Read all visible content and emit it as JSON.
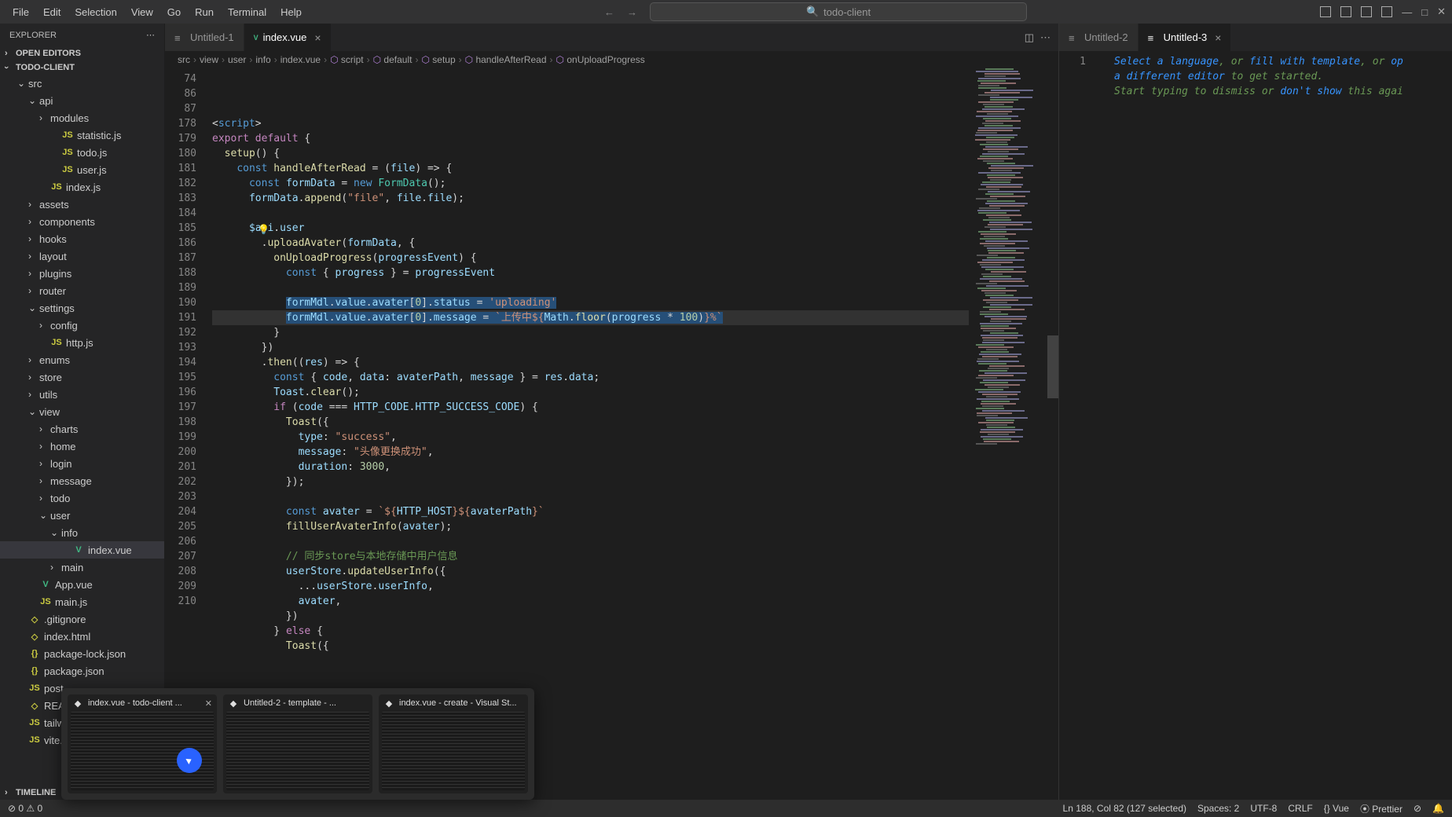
{
  "menu": [
    "File",
    "Edit",
    "Selection",
    "View",
    "Go",
    "Run",
    "Terminal",
    "Help"
  ],
  "searchPlaceholder": "todo-client",
  "explorer": {
    "title": "EXPLORER",
    "openEditors": "OPEN EDITORS",
    "project": "TODO-CLIENT",
    "timeline": "TIMELINE",
    "tree": [
      {
        "depth": 1,
        "type": "folder",
        "open": true,
        "label": "src"
      },
      {
        "depth": 2,
        "type": "folder",
        "open": true,
        "label": "api"
      },
      {
        "depth": 3,
        "type": "folder",
        "open": false,
        "label": "modules"
      },
      {
        "depth": 4,
        "type": "js",
        "label": "statistic.js"
      },
      {
        "depth": 4,
        "type": "js",
        "label": "todo.js"
      },
      {
        "depth": 4,
        "type": "js",
        "label": "user.js"
      },
      {
        "depth": 3,
        "type": "js",
        "label": "index.js"
      },
      {
        "depth": 2,
        "type": "folder",
        "open": false,
        "label": "assets"
      },
      {
        "depth": 2,
        "type": "folder",
        "open": false,
        "label": "components"
      },
      {
        "depth": 2,
        "type": "folder",
        "open": false,
        "label": "hooks"
      },
      {
        "depth": 2,
        "type": "folder",
        "open": false,
        "label": "layout"
      },
      {
        "depth": 2,
        "type": "folder",
        "open": false,
        "label": "plugins"
      },
      {
        "depth": 2,
        "type": "folder",
        "open": false,
        "label": "router"
      },
      {
        "depth": 2,
        "type": "folder",
        "open": true,
        "label": "settings"
      },
      {
        "depth": 3,
        "type": "folder",
        "open": false,
        "label": "config"
      },
      {
        "depth": 3,
        "type": "js",
        "label": "http.js"
      },
      {
        "depth": 2,
        "type": "folder",
        "open": false,
        "label": "enums"
      },
      {
        "depth": 2,
        "type": "folder",
        "open": false,
        "label": "store"
      },
      {
        "depth": 2,
        "type": "folder",
        "open": false,
        "label": "utils"
      },
      {
        "depth": 2,
        "type": "folder",
        "open": true,
        "label": "view"
      },
      {
        "depth": 3,
        "type": "folder",
        "open": false,
        "label": "charts"
      },
      {
        "depth": 3,
        "type": "folder",
        "open": false,
        "label": "home"
      },
      {
        "depth": 3,
        "type": "folder",
        "open": false,
        "label": "login"
      },
      {
        "depth": 3,
        "type": "folder",
        "open": false,
        "label": "message"
      },
      {
        "depth": 3,
        "type": "folder",
        "open": false,
        "label": "todo"
      },
      {
        "depth": 3,
        "type": "folder",
        "open": true,
        "label": "user"
      },
      {
        "depth": 4,
        "type": "folder",
        "open": true,
        "label": "info"
      },
      {
        "depth": 5,
        "type": "vue",
        "label": "index.vue",
        "selected": true
      },
      {
        "depth": 4,
        "type": "folder",
        "open": false,
        "label": "main"
      },
      {
        "depth": 2,
        "type": "vue",
        "label": "App.vue"
      },
      {
        "depth": 2,
        "type": "js",
        "label": "main.js"
      },
      {
        "depth": 1,
        "type": "file",
        "label": ".gitignore"
      },
      {
        "depth": 1,
        "type": "file",
        "label": "index.html"
      },
      {
        "depth": 1,
        "type": "json",
        "label": "package-lock.json"
      },
      {
        "depth": 1,
        "type": "json",
        "label": "package.json"
      },
      {
        "depth": 1,
        "type": "js",
        "label": "post"
      },
      {
        "depth": 1,
        "type": "file",
        "label": "REA"
      },
      {
        "depth": 1,
        "type": "js",
        "label": "tailw"
      },
      {
        "depth": 1,
        "type": "js",
        "label": "vite.c"
      }
    ]
  },
  "leftTabs": [
    {
      "label": "Untitled-1",
      "active": false
    },
    {
      "label": "index.vue",
      "active": true,
      "icon": "vue"
    }
  ],
  "rightTabs": [
    {
      "label": "Untitled-2",
      "active": false
    },
    {
      "label": "Untitled-3",
      "active": true
    }
  ],
  "breadcrumbs": [
    "src",
    "view",
    "user",
    "info",
    "index.vue",
    "script",
    "default",
    "setup",
    "handleAfterRead",
    "onUploadProgress"
  ],
  "rightEditor": {
    "lineNo": "1",
    "text1a": "Select a language",
    "text1b": ", or ",
    "link1": "fill with template",
    "text1c": ", or ",
    "link2": "op",
    "text2a": "a different editor",
    "text2b": " to get started.",
    "text3a": "Start typing to dismiss or ",
    "link3": "don't show",
    "text3b": " this agai"
  },
  "code": {
    "lines": [
      {
        "n": 74,
        "html": "<span class='op'>&lt;</span><span class='kw'>script</span><span class='op'>&gt;</span>"
      },
      {
        "n": 86,
        "html": "<span class='kw2'>export</span> <span class='kw2'>default</span> <span class='op'>{</span>"
      },
      {
        "n": 87,
        "html": "  <span class='fn'>setup</span><span class='op'>() {</span>"
      },
      {
        "n": 178,
        "html": "    <span class='kw'>const</span> <span class='fn'>handleAfterRead</span> <span class='op'>= (</span><span class='var'>file</span><span class='op'>) =&gt; {</span>"
      },
      {
        "n": 179,
        "html": "      <span class='kw'>const</span> <span class='var'>formData</span> <span class='op'>=</span> <span class='kw'>new</span> <span class='cls'>FormData</span><span class='op'>();</span>"
      },
      {
        "n": 180,
        "html": "      <span class='var'>formData</span><span class='op'>.</span><span class='fn'>append</span><span class='op'>(</span><span class='str'>\"file\"</span><span class='op'>, </span><span class='var'>file</span><span class='op'>.</span><span class='var'>file</span><span class='op'>);</span>"
      },
      {
        "n": 181,
        "html": ""
      },
      {
        "n": 182,
        "html": "      <span class='var'>$api</span><span class='op'>.</span><span class='var'>user</span>"
      },
      {
        "n": 183,
        "html": "        <span class='op'>.</span><span class='fn'>uploadAvater</span><span class='op'>(</span><span class='var'>formData</span><span class='op'>, {</span>"
      },
      {
        "n": 184,
        "html": "          <span class='fn'>onUploadProgress</span><span class='op'>(</span><span class='var'>progressEvent</span><span class='op'>) {</span>"
      },
      {
        "n": 185,
        "html": "            <span class='kw'>const</span> <span class='op'>{ </span><span class='var'>progress</span><span class='op'> } = </span><span class='var'>progressEvent</span>"
      },
      {
        "n": 186,
        "html": ""
      },
      {
        "n": 187,
        "html": "            <span class='sel-bg'><span class='var'>formMdl</span><span class='op'>.</span><span class='var'>value</span><span class='op'>.</span><span class='var'>avater</span><span class='op'>[</span><span class='num'>0</span><span class='op'>].</span><span class='var'>status</span><span class='op'> = </span><span class='str'>'uploading'</span></span>"
      },
      {
        "n": 188,
        "hl": true,
        "html": "            <span class='sel-bg'><span class='var'>formMdl</span><span class='op'>.</span><span class='var'>value</span><span class='op'>.</span><span class='var'>avater</span><span class='op'>[</span><span class='num'>0</span><span class='op'>].</span><span class='var'>message</span><span class='op'> = </span><span class='str'>`上传中${</span><span class='var'>Math</span><span class='op'>.</span><span class='fn'>floor</span><span class='op'>(</span><span class='var'>progress</span><span class='op'> * </span><span class='num'>100</span><span class='op'>)</span><span class='str'>}%`</span></span>"
      },
      {
        "n": 189,
        "html": "          <span class='op'>}</span>"
      },
      {
        "n": 190,
        "html": "        <span class='op'>})</span>"
      },
      {
        "n": 191,
        "html": "        <span class='op'>.</span><span class='fn'>then</span><span class='op'>((</span><span class='var'>res</span><span class='op'>) =&gt; {</span>"
      },
      {
        "n": 192,
        "html": "          <span class='kw'>const</span> <span class='op'>{ </span><span class='var'>code</span><span class='op'>, </span><span class='var'>data</span><span class='op'>: </span><span class='var'>avaterPath</span><span class='op'>, </span><span class='var'>message</span><span class='op'> } = </span><span class='var'>res</span><span class='op'>.</span><span class='var'>data</span><span class='op'>;</span>"
      },
      {
        "n": 193,
        "html": "          <span class='var'>Toast</span><span class='op'>.</span><span class='fn'>clear</span><span class='op'>();</span>"
      },
      {
        "n": 194,
        "html": "          <span class='kw2'>if</span> <span class='op'>(</span><span class='var'>code</span><span class='op'> === </span><span class='var'>HTTP_CODE</span><span class='op'>.</span><span class='var'>HTTP_SUCCESS_CODE</span><span class='op'>) {</span>"
      },
      {
        "n": 195,
        "html": "            <span class='fn'>Toast</span><span class='op'>({</span>"
      },
      {
        "n": 196,
        "html": "              <span class='var'>type</span><span class='op'>: </span><span class='str'>\"success\"</span><span class='op'>,</span>"
      },
      {
        "n": 197,
        "html": "              <span class='var'>message</span><span class='op'>: </span><span class='str'>\"头像更换成功\"</span><span class='op'>,</span>"
      },
      {
        "n": 198,
        "html": "              <span class='var'>duration</span><span class='op'>: </span><span class='num'>3000</span><span class='op'>,</span>"
      },
      {
        "n": 199,
        "html": "            <span class='op'>});</span>"
      },
      {
        "n": 200,
        "html": ""
      },
      {
        "n": 201,
        "html": "            <span class='kw'>const</span> <span class='var'>avater</span> <span class='op'>= </span><span class='str'>`${</span><span class='var'>HTTP_HOST</span><span class='str'>}${</span><span class='var'>avaterPath</span><span class='str'>}`</span>"
      },
      {
        "n": 202,
        "html": "            <span class='fn'>fillUserAvaterInfo</span><span class='op'>(</span><span class='var'>avater</span><span class='op'>);</span>"
      },
      {
        "n": 203,
        "html": ""
      },
      {
        "n": 204,
        "html": "            <span class='cmt'>// 同步store与本地存储中用户信息</span>"
      },
      {
        "n": 205,
        "html": "            <span class='var'>userStore</span><span class='op'>.</span><span class='fn'>updateUserInfo</span><span class='op'>({</span>"
      },
      {
        "n": 206,
        "html": "              <span class='op'>...</span><span class='var'>userStore</span><span class='op'>.</span><span class='var'>userInfo</span><span class='op'>,</span>"
      },
      {
        "n": 207,
        "html": "              <span class='var'>avater</span><span class='op'>,</span>"
      },
      {
        "n": 208,
        "html": "            <span class='op'>})</span>"
      },
      {
        "n": 209,
        "html": "          <span class='op'>}</span> <span class='kw2'>else</span> <span class='op'>{</span>"
      },
      {
        "n": 210,
        "html": "            <span class='fn'>Toast</span><span class='op'>({</span>"
      }
    ]
  },
  "status": {
    "leftItems": [
      "⊘ 0 ⚠ 0"
    ],
    "rightItems": [
      "Ln 188, Col 82 (127 selected)",
      "Spaces: 2",
      "UTF-8",
      "CRLF",
      "{} Vue",
      "⦿ Prettier",
      "⊘",
      "🔔"
    ]
  },
  "taskPreview": [
    {
      "label": "index.vue - todo-client ...",
      "close": true
    },
    {
      "label": "Untitled-2 - template - ..."
    },
    {
      "label": "index.vue - create - Visual St..."
    }
  ]
}
